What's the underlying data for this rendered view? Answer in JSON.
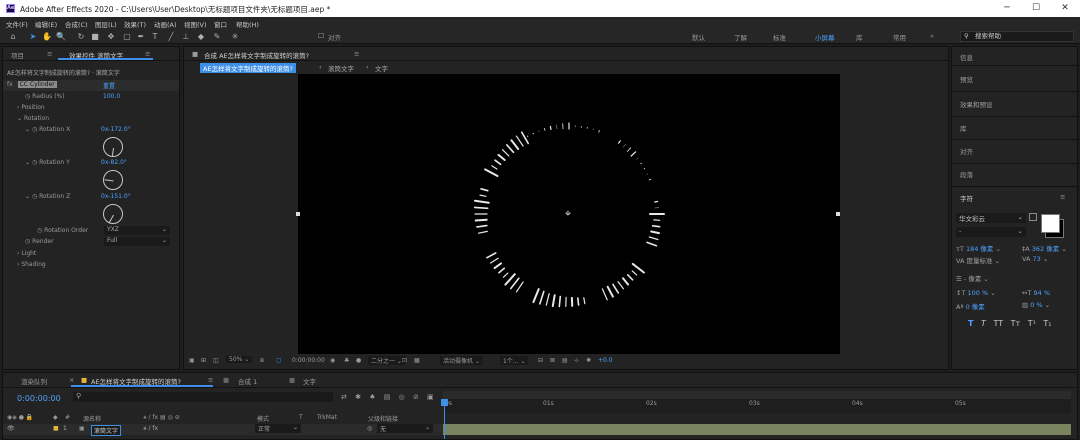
{
  "window": {
    "title": "Adobe After Effects 2020 - C:\\Users\\User\\Desktop\\无标题项目文件夹\\无标题项目.aep *",
    "minimize": "─",
    "maximize": "☐",
    "close": "✕",
    "app_badge": "Ae"
  },
  "menu": [
    "文件(F)",
    "编辑(E)",
    "合成(C)",
    "图层(L)",
    "效果(T)",
    "动画(A)",
    "视图(V)",
    "窗口",
    "帮助(H)"
  ],
  "toolbar": {
    "align_label": "对齐",
    "workspaces": [
      "默认",
      "了解",
      "标准",
      "小屏幕",
      "库",
      "常用"
    ],
    "active_workspace": "小屏幕",
    "more": "»",
    "search_placeholder": "搜索帮助"
  },
  "left_panel": {
    "tabs": [
      "项目",
      "效果控件 滚筒文字"
    ],
    "breadcrumb": "AE怎样将文字制成旋转的滚筒? · 滚筒文字",
    "effect": {
      "name": "CC Cylinder",
      "reset": "重置"
    },
    "props": [
      {
        "label": "Radius (%)",
        "value": "100.0"
      },
      {
        "label": "Position",
        "value": ""
      },
      {
        "label": "Rotation",
        "value": ""
      },
      {
        "label": "Rotation X",
        "value": "0x-172.0°"
      },
      {
        "label": "Rotation Y",
        "value": "0x-82.0°"
      },
      {
        "label": "Rotation Z",
        "value": "0x-151.0°"
      },
      {
        "label": "Rotation Order",
        "value": "YXZ"
      },
      {
        "label": "Render",
        "value": "Full"
      },
      {
        "label": "Light",
        "value": ""
      },
      {
        "label": "Shading",
        "value": ""
      }
    ]
  },
  "comp": {
    "tab": "合成 AE怎样将文字制成旋转的滚筒?",
    "breadcrumbs": [
      "AE怎样将文字制成旋转的滚筒?",
      "滚筒文字",
      "文字"
    ],
    "footer": {
      "zoom": "50%",
      "time": "0:00:00:00",
      "resolution": "二分之一",
      "camera": "活动摄像机",
      "views": "1个...",
      "exposure": "+0.0"
    }
  },
  "right_panel": {
    "items": [
      "信息",
      "预览",
      "效果和预设",
      "库",
      "对齐",
      "段落"
    ],
    "character": {
      "title": "字符",
      "font": "华文彩云",
      "style": "-",
      "size": "184 像素",
      "leading": "362 像素",
      "kerning": "度量标准",
      "tracking": "73",
      "indent": "- 像素",
      "vscale": "100 %",
      "hscale": "94 %",
      "baseline": "0 像素",
      "tsume": "0 %",
      "styles": [
        "T",
        "T",
        "TT",
        "Tт",
        "T¹",
        "T₁"
      ]
    }
  },
  "timeline": {
    "tabs": [
      "渲染队列",
      "AE怎样将文字制成旋转的滚筒?",
      "合成 1",
      "文字"
    ],
    "timecode": "0:00:00:00",
    "headers": [
      "源名称",
      "模式",
      "T",
      "TrkMat",
      "父级和链接"
    ],
    "layer": {
      "index": "1",
      "name": "滚筒文字",
      "mode": "正常",
      "parent": "无"
    },
    "ruler": [
      "0s",
      "01s",
      "02s",
      "03s",
      "04s",
      "05s"
    ]
  },
  "colors": {
    "accent": "#3d8fe8",
    "panel": "#232323"
  }
}
